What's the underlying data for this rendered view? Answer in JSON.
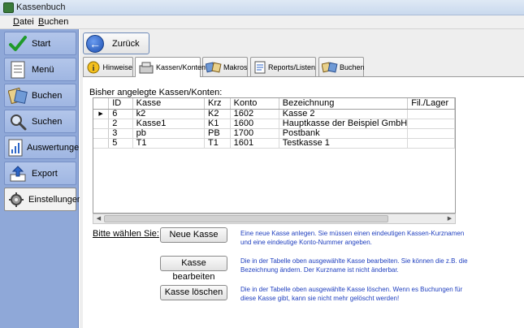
{
  "window": {
    "title": "Kassenbuch"
  },
  "menu": [
    {
      "accel": "D",
      "rest": "atei"
    },
    {
      "accel": "B",
      "rest": "uchen"
    }
  ],
  "sidebar": {
    "items": [
      {
        "label": "Start",
        "icon": "checkmark-icon"
      },
      {
        "label": "Menü",
        "icon": "menu-icon"
      },
      {
        "label": "Buchen",
        "icon": "cash-book-icon"
      },
      {
        "label": "Suchen",
        "icon": "magnifier-icon"
      },
      {
        "label": "Auswertungen",
        "icon": "report-icon"
      },
      {
        "label": "Export",
        "icon": "export-icon"
      },
      {
        "label": "Einstellungen",
        "icon": "settings-icon",
        "active": true
      }
    ]
  },
  "toolbar": {
    "back_label": "Zurück"
  },
  "tabs": [
    {
      "label": "Hinweise",
      "icon": "info-icon"
    },
    {
      "label": "Kassen/Konten",
      "icon": "cash-register-icon",
      "active": true
    },
    {
      "label": "Makros",
      "icon": "macros-icon"
    },
    {
      "label": "Reports/Listen",
      "icon": "reports-icon"
    },
    {
      "label": "Buchen",
      "icon": "booking-icon"
    }
  ],
  "section": {
    "label": "Bisher angelegte Kassen/Konten:"
  },
  "table": {
    "columns": [
      "ID",
      "Kasse",
      "Krz",
      "Konto",
      "Bezeichnung",
      "Fil./Lager"
    ],
    "rows": [
      [
        "6",
        "k2",
        "K2",
        "1602",
        "Kasse 2",
        ""
      ],
      [
        "2",
        "Kasse1",
        "K1",
        "1600",
        "Hauptkasse der Beispiel GmbH",
        ""
      ],
      [
        "3",
        "pb",
        "PB",
        "1700",
        "Postbank",
        ""
      ],
      [
        "5",
        "T1",
        "T1",
        "1601",
        "Testkasse 1",
        ""
      ]
    ],
    "selected_row": 0
  },
  "actions": {
    "prompt": "Bitte wählen Sie:",
    "new_label": "Neue Kasse",
    "new_desc": "Eine neue Kasse anlegen. Sie müssen einen eindeutigen Kassen-Kurznamen und eine eindeutige Konto-Nummer angeben.",
    "edit_label": "Kasse bearbeiten",
    "edit_desc": "Die in der Tabelle oben ausgewählte Kasse bearbeiten.  Sie können die z.B. die Bezeichnung ändern. Der Kurzname ist nicht änderbar.",
    "delete_label": "Kasse löschen",
    "delete_desc": "Die in der Tabelle oben ausgewählte Kasse löschen. Wenn es Buchungen für diese Kasse gibt, kann sie nicht mehr gelöscht werden!"
  },
  "colors": {
    "sidebar": "#8fa8d8",
    "link_text": "#1f3fbf",
    "accent": "#1c4fb0"
  }
}
